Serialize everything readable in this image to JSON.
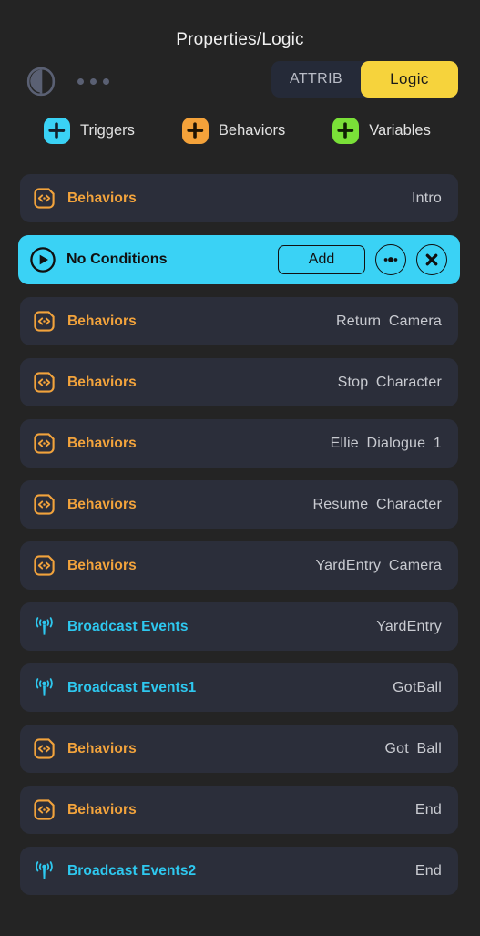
{
  "header": {
    "title": "Properties/Logic",
    "split_icon": "panel-split-icon",
    "overflow_icon": "more-dots-icon",
    "segmented": {
      "attrib_label": "ATTRIB",
      "logic_label": "Logic",
      "selected": "Logic",
      "active_color": "#f6d33c"
    }
  },
  "tabs": [
    {
      "label": "Triggers",
      "color": "#3ad2f5",
      "icon": "add-trigger-icon"
    },
    {
      "label": "Behaviors",
      "color": "#f4a23a",
      "icon": "add-behavior-icon"
    },
    {
      "label": "Variables",
      "color": "#7ae038",
      "icon": "add-variable-icon"
    }
  ],
  "selected_row": {
    "label": "No Conditions",
    "icon": "play-circle-icon",
    "add_label": "Add",
    "more_icon": "more-circle-icon",
    "close_icon": "close-circle-icon",
    "background": "#3ad2f5"
  },
  "rows": [
    {
      "type": "behaviors",
      "label": "Behaviors",
      "value": "Intro",
      "icon": "behavior-code-icon"
    },
    {
      "type": "behaviors",
      "label": "Behaviors",
      "value": "Return Camera",
      "icon": "behavior-code-icon"
    },
    {
      "type": "behaviors",
      "label": "Behaviors",
      "value": "Stop Character",
      "icon": "behavior-code-icon"
    },
    {
      "type": "behaviors",
      "label": "Behaviors",
      "value": "Ellie Dialogue 1",
      "icon": "behavior-code-icon"
    },
    {
      "type": "behaviors",
      "label": "Behaviors",
      "value": "Resume Character",
      "icon": "behavior-code-icon"
    },
    {
      "type": "behaviors",
      "label": "Behaviors",
      "value": "YardEntry Camera",
      "icon": "behavior-code-icon"
    },
    {
      "type": "broadcast",
      "label": "Broadcast Events",
      "value": "YardEntry",
      "icon": "broadcast-antenna-icon"
    },
    {
      "type": "broadcast",
      "label": "Broadcast Events1",
      "value": "GotBall",
      "icon": "broadcast-antenna-icon"
    },
    {
      "type": "behaviors",
      "label": "Behaviors",
      "value": "Got Ball",
      "icon": "behavior-code-icon"
    },
    {
      "type": "behaviors",
      "label": "Behaviors",
      "value": "End",
      "icon": "behavior-code-icon"
    },
    {
      "type": "broadcast",
      "label": "Broadcast Events2",
      "value": "End",
      "icon": "broadcast-antenna-icon"
    }
  ]
}
